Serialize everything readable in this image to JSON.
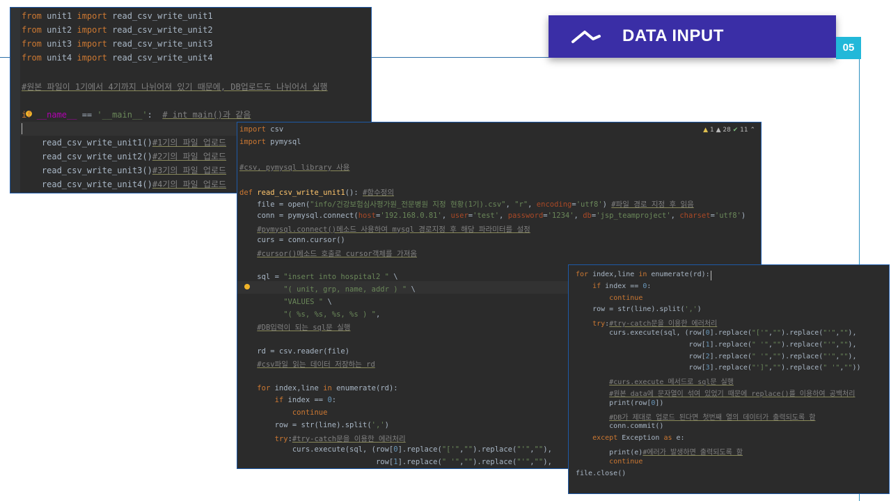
{
  "slide": {
    "header_title": "DATA INPUT",
    "page_number": "05",
    "icon": "chart-peak-icon"
  },
  "editor_main": {
    "lines": [
      "from unit1 import read_csv_write_unit1",
      "from unit2 import read_csv_write_unit2",
      "from unit3 import read_csv_write_unit3",
      "from unit4 import read_csv_write_unit4",
      "",
      "#원본 파일이 1기에서 4기까지 나뉘어져 있기 때문에, DB업로드도 나뉘어서 실행",
      "",
      "if __name__ == '__main__':  # int main()과 같음",
      "",
      "    read_csv_write_unit1()#1기의 파일 업로드",
      "    read_csv_write_unit2()#2기의 파일 업로드",
      "    read_csv_write_unit3()#3기의 파일 업로드",
      "    read_csv_write_unit4()#4기의 파일 업로드"
    ]
  },
  "editor_unit": {
    "status": {
      "warnings": "1",
      "weak_warnings": "28",
      "ok": "11"
    },
    "lines": [
      "import csv",
      "import pymysql",
      "",
      "#csv, pymysql library 사용",
      "",
      "def read_csv_write_unit1(): #함수정의",
      "    file = open(\"info/건강보험심사평가원_전문병원 지정 현황(1기).csv\", \"r\", encoding='utf8') #파일 경로 지정 후 읽음",
      "    conn = pymysql.connect(host='192.168.0.81', user='test', password='1234', db='jsp_teamproject', charset='utf8')",
      "    #pymysql.connect()메소드 사용하여 mysql 경로지정 후 해당 파라미터를 설정",
      "    curs = conn.cursor()",
      "    #cursor()메소드 호출로 cursor객체를 가져옴",
      "",
      "    sql = \"insert into hospital2 \" \\",
      "          \"( unit, grp, name, addr ) \" \\",
      "          \"VALUES \" \\",
      "          \"( %s, %s, %s, %s ) \",",
      "    #DB입력이 되는 sql문 실행",
      "",
      "    rd = csv.reader(file)",
      "    #csv파일 읽는 데이터 저장하는 rd",
      "",
      "    for index,line in enumerate(rd):",
      "        if index == 0:",
      "            continue",
      "        row = str(line).split(',')",
      "        try:#try-catch문을 이용한 에러처리",
      "            curs.execute(sql, (row[0].replace(\"['\",\"\").replace(\"'\",\"\"),",
      "                               row[1].replace(\" '\",\"\").replace(\"'\",\"\"),"
    ]
  },
  "editor_loop": {
    "lines": [
      "for index,line in enumerate(rd):",
      "    if index == 0:",
      "        continue",
      "    row = str(line).split(',')",
      "    try:#try-catch문을 이용한 에러처리",
      "        curs.execute(sql, (row[0].replace(\"['\",\"\").replace(\"'\",\"\"),",
      "                           row[1].replace(\" '\",\"\").replace(\"'\",\"\"),",
      "                           row[2].replace(\" '\",\"\").replace(\"'\",\"\"),",
      "                           row[3].replace(\"']\",\"\").replace(\" '\",\"\"))",
      "        #curs.execute 메서드로 sql문 실행",
      "        #원본 data에 문자열이 섞여 있었기 때문에 replace()를 이용하여 공백처리",
      "        print(row[0])",
      "        #DB가 제대로 업로드 된다면 첫번째 열의 데이터가 출력되도록 함",
      "        conn.commit()",
      "    except Exception as e:",
      "        print(e)#에러가 발생하면 출력되도록 함",
      "        continue",
      "file.close()"
    ]
  }
}
